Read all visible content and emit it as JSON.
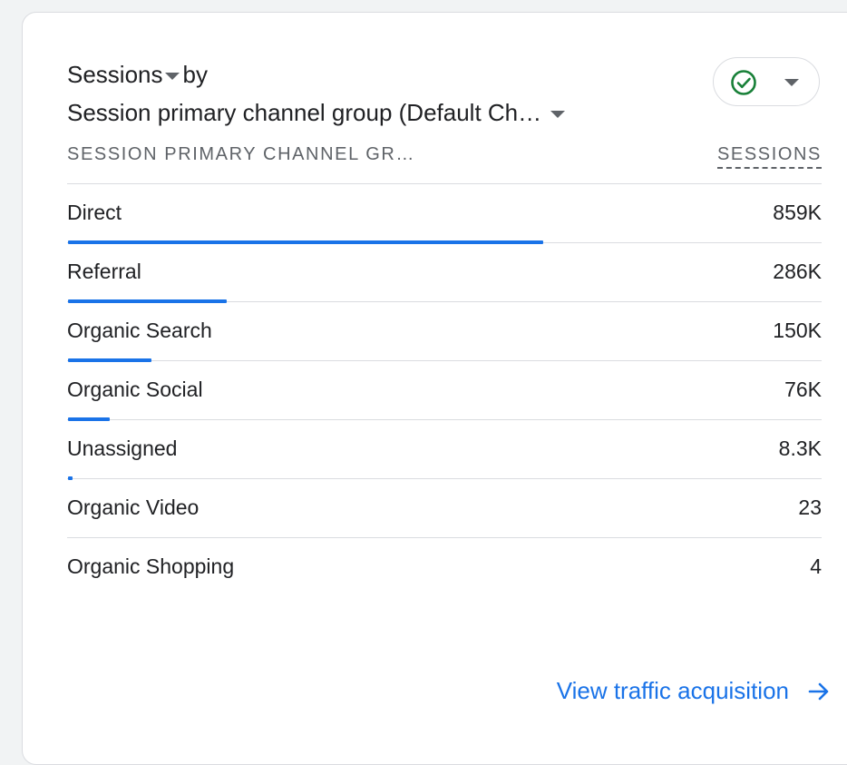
{
  "header": {
    "metric_label": "Sessions",
    "by_label": "by",
    "dimension_label": "Session primary channel group (Default Ch…",
    "status_icon": "check-circle-icon",
    "status_color": "#188038"
  },
  "table": {
    "column_dimension": "SESSION PRIMARY CHANNEL GR…",
    "column_metric": "SESSIONS",
    "rows": [
      {
        "label": "Direct",
        "value": "859K",
        "share": 0.6301
      },
      {
        "label": "Referral",
        "value": "286K",
        "share": 0.2098
      },
      {
        "label": "Organic Search",
        "value": "150K",
        "share": 0.11
      },
      {
        "label": "Organic Social",
        "value": "76K",
        "share": 0.0558
      },
      {
        "label": "Unassigned",
        "value": "8.3K",
        "share": 0.0061
      },
      {
        "label": "Organic Video",
        "value": "23",
        "share": 0
      },
      {
        "label": "Organic Shopping",
        "value": "4",
        "share": 0
      }
    ]
  },
  "footer": {
    "link_label": "View traffic acquisition",
    "link_icon": "arrow-right-icon"
  },
  "colors": {
    "accent": "#1a73e8",
    "text": "#202124",
    "muted": "#5f6368",
    "divider": "#dadce0"
  }
}
